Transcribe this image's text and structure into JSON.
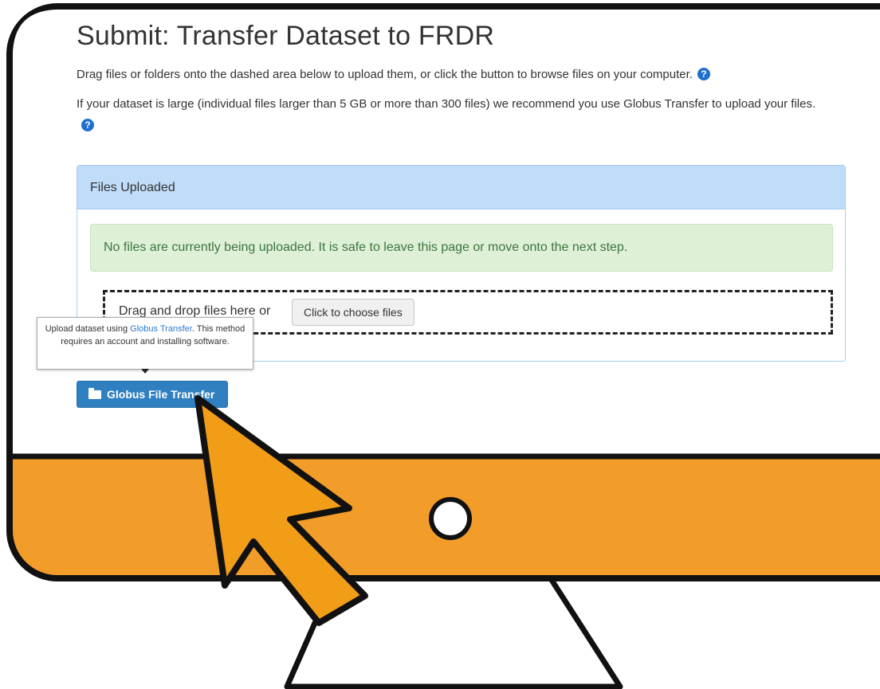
{
  "page": {
    "title": "Submit: Transfer Dataset to FRDR",
    "intro": "Drag files or folders onto the dashed area below to upload them, or click the button to browse files on your computer.",
    "large_dataset_note": "If your dataset is large (individual files larger than 5 GB or more than 300 files) we recommend you use Globus Transfer to upload your files.",
    "help_icon_glyph": "?"
  },
  "panel": {
    "heading": "Files Uploaded",
    "alert_text": "No files are currently being uploaded. It is safe to leave this page or move onto the next step.",
    "dropzone_label": "Drag and drop files here or",
    "choose_button": "Click to choose files"
  },
  "tooltip": {
    "text_before": "Upload dataset using ",
    "link_text": "Globus Transfer",
    "text_after": ". This method requires an account and installing software."
  },
  "globus_button": {
    "label": "Globus File Transfer",
    "icon": "folder-open-icon"
  },
  "colors": {
    "monitor_bezel": "#f29d2a",
    "cursor_fill": "#f29d18",
    "globus_button": "#2f7fc1",
    "panel_heading": "#bfdcf8",
    "alert_bg": "#dff0d8"
  }
}
